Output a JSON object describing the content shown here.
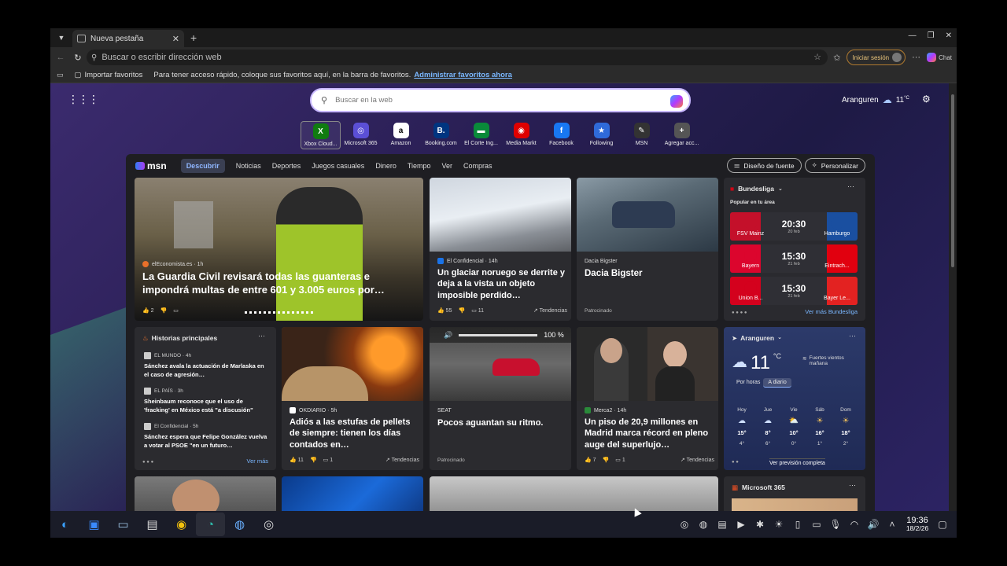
{
  "browser": {
    "tab_title": "Nueva pestaña",
    "address_placeholder": "Buscar o escribir dirección web",
    "signin_label": "Iniciar sesión",
    "chat_label": "Chat",
    "favorites": {
      "import_label": "Importar favoritos",
      "message": "Para tener acceso rápido, coloque sus favoritos aquí, en la barra de favoritos.",
      "manage_link": "Administrar favoritos ahora"
    }
  },
  "newtab": {
    "search_placeholder": "Buscar en la web",
    "location": "Aranguren",
    "temp": "11",
    "temp_unit": "°C",
    "quick_links": [
      {
        "label": "Xbox Cloud...",
        "icon": "xbox-icon",
        "color": "#107c10",
        "glyph": "X"
      },
      {
        "label": "Microsoft 365",
        "icon": "m365-icon",
        "color": "#5b4fd6",
        "glyph": "◎"
      },
      {
        "label": "Amazon",
        "icon": "amazon-icon",
        "color": "#ffffff",
        "glyph": "a"
      },
      {
        "label": "Booking.com",
        "icon": "booking-icon",
        "color": "#003580",
        "glyph": "B."
      },
      {
        "label": "El Corte Ing...",
        "icon": "elcorteingles-icon",
        "color": "#0a8a3a",
        "glyph": "▬"
      },
      {
        "label": "Media Markt",
        "icon": "mediamarkt-icon",
        "color": "#df0000",
        "glyph": "◉"
      },
      {
        "label": "Facebook",
        "icon": "facebook-icon",
        "color": "#1877f2",
        "glyph": "f"
      },
      {
        "label": "Following",
        "icon": "following-icon",
        "color": "#2f6ad9",
        "glyph": "★"
      },
      {
        "label": "MSN",
        "icon": "msn-icon",
        "color": "#333333",
        "glyph": "✎"
      },
      {
        "label": "Agregar acc...",
        "icon": "add-icon",
        "color": "#555555",
        "glyph": "+"
      }
    ]
  },
  "msn": {
    "logo": "msn",
    "tabs": [
      "Descubrir",
      "Noticias",
      "Deportes",
      "Juegos casuales",
      "Dinero",
      "Tiempo",
      "Ver",
      "Compras"
    ],
    "design_btn": "Diseño de fuente",
    "personalize_btn": "Personalizar",
    "hero": {
      "source": "elEconomista.es · 1h",
      "headline": "La Guardia Civil revisará todas las guanteras e impondrá multas de entre 601 y 3.005 euros por…",
      "likes": "2"
    },
    "glacier": {
      "source": "El Confidencial · 14h",
      "headline": "Un glaciar noruego se derrite y deja a la vista un objeto imposible perdido…",
      "likes": "55",
      "comments": "11",
      "trend": "Tendencias"
    },
    "dacia": {
      "source": "Dacia Bigster",
      "headline": "Dacia Bigster",
      "sponsored": "Patrocinado"
    },
    "sports": {
      "league": "Bundesliga",
      "subtitle": "Popular en tu área",
      "more": "Ver más Bundesliga",
      "matches": [
        {
          "home": "FSV Mainz",
          "away": "Hamburgo",
          "time": "20:30",
          "date": "20 feb",
          "hc": "#c4102a",
          "ac": "#1a4fa0"
        },
        {
          "home": "Bayern",
          "away": "Eintrach...",
          "time": "15:30",
          "date": "21 feb",
          "hc": "#dc052d",
          "ac": "#e1000f"
        },
        {
          "home": "Union B...",
          "away": "Bayer Le...",
          "time": "15:30",
          "date": "21 feb",
          "hc": "#d4011d",
          "ac": "#e32221"
        }
      ]
    },
    "top_stories": {
      "title": "Historias principales",
      "more": "Ver más",
      "items": [
        {
          "source": "EL MUNDO · 4h",
          "title": "Sánchez avala la actuación de Marlaska en el caso de agresión…"
        },
        {
          "source": "EL PAÍS · 3h",
          "title": "Sheinbaum reconoce que el uso de 'fracking' en México está \"a discusión\""
        },
        {
          "source": "El Confidencial · 5h",
          "title": "Sánchez espera que Felipe González vuelva a votar al PSOE \"en un futuro…"
        }
      ]
    },
    "pellets": {
      "source": "OKDIARIO · 5h",
      "headline": "Adiós a las estufas de pellets de siempre: tienen los días contados en…",
      "likes": "11",
      "comments": "1",
      "trend": "Tendencias"
    },
    "seat": {
      "source": "SEAT",
      "headline": "Pocos aguantan su ritmo.",
      "sponsored": "Patrocinado",
      "volume": "100 %",
      "volume_level": 1.0
    },
    "piso": {
      "source": "Merca2 · 14h",
      "headline": "Un piso de 20,9 millones en Madrid marca récord en pleno auge del superlujo…",
      "likes": "7",
      "comments": "1",
      "trend": "Tendencias"
    },
    "weather": {
      "location": "Aranguren",
      "temp": "11",
      "unit": "°C",
      "alert": "Fuertes vientos mañana",
      "tab_hourly": "Por horas",
      "tab_daily": "A diario",
      "more": "Ver previsión completa",
      "days": [
        {
          "d": "Hoy",
          "hi": "15°",
          "lo": "4°"
        },
        {
          "d": "Jue",
          "hi": "8°",
          "lo": "6°"
        },
        {
          "d": "Vie",
          "hi": "10°",
          "lo": "0°"
        },
        {
          "d": "Sáb",
          "hi": "16°",
          "lo": "1°"
        },
        {
          "d": "Dom",
          "hi": "18°",
          "lo": "2°"
        }
      ]
    },
    "m365": {
      "title": "Microsoft 365"
    }
  },
  "taskbar": {
    "time": "19:36",
    "date": "18/2/26"
  }
}
